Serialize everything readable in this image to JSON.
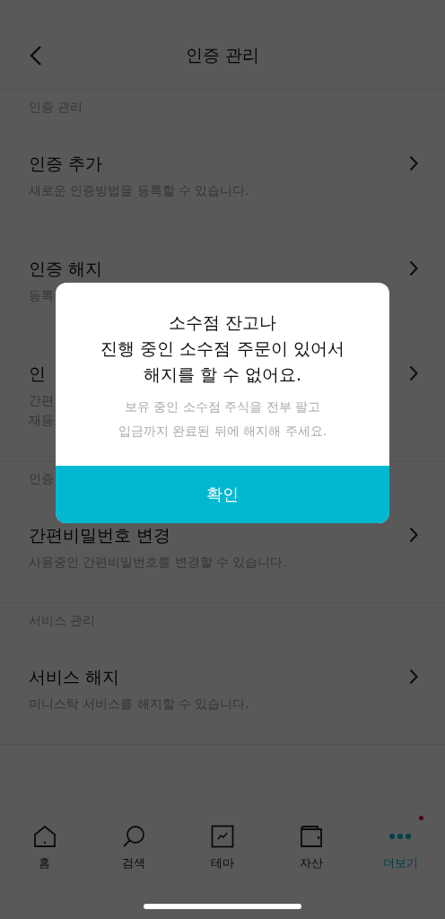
{
  "header": {
    "title": "인증 관리"
  },
  "sections": [
    {
      "label": "인증 관리",
      "items": [
        {
          "title": "인증 추가",
          "description_lines": [
            "새로운 인증방법을 등록할 수 있습니다."
          ]
        },
        {
          "title": "인증 해지",
          "description_lines": [
            "등록"
          ]
        },
        {
          "title": "인",
          "description_lines": [
            "간편",
            "재등"
          ]
        }
      ]
    },
    {
      "label": "인증",
      "items": [
        {
          "title": "간편비밀번호 변경",
          "description_lines": [
            "사용중인 간편비밀번호를 변경할 수 있습니다."
          ]
        }
      ]
    },
    {
      "label": "서비스 관리",
      "items": [
        {
          "title": "서비스 해지",
          "description_lines": [
            "미니스탁 서비스를 해지할 수 있습니다."
          ]
        }
      ]
    }
  ],
  "tab_bar": [
    {
      "kind": "home",
      "label": "홈",
      "selected": false,
      "badge": false
    },
    {
      "kind": "search",
      "label": "검색",
      "selected": false,
      "badge": false
    },
    {
      "kind": "theme",
      "label": "테마",
      "selected": false,
      "badge": false
    },
    {
      "kind": "assets",
      "label": "자산",
      "selected": false,
      "badge": false
    },
    {
      "kind": "more",
      "label": "더보기",
      "selected": true,
      "badge": true
    }
  ],
  "dialog": {
    "title": "소수점 잔고나\n진행 중인 소수점 주문이 있어서\n해지를 할 수 없어요.",
    "message": "보유 중인 소수점 주식을 전부 팔고\n입금까지 완료된 뒤에 해지해 주세요.",
    "button": "확인"
  }
}
